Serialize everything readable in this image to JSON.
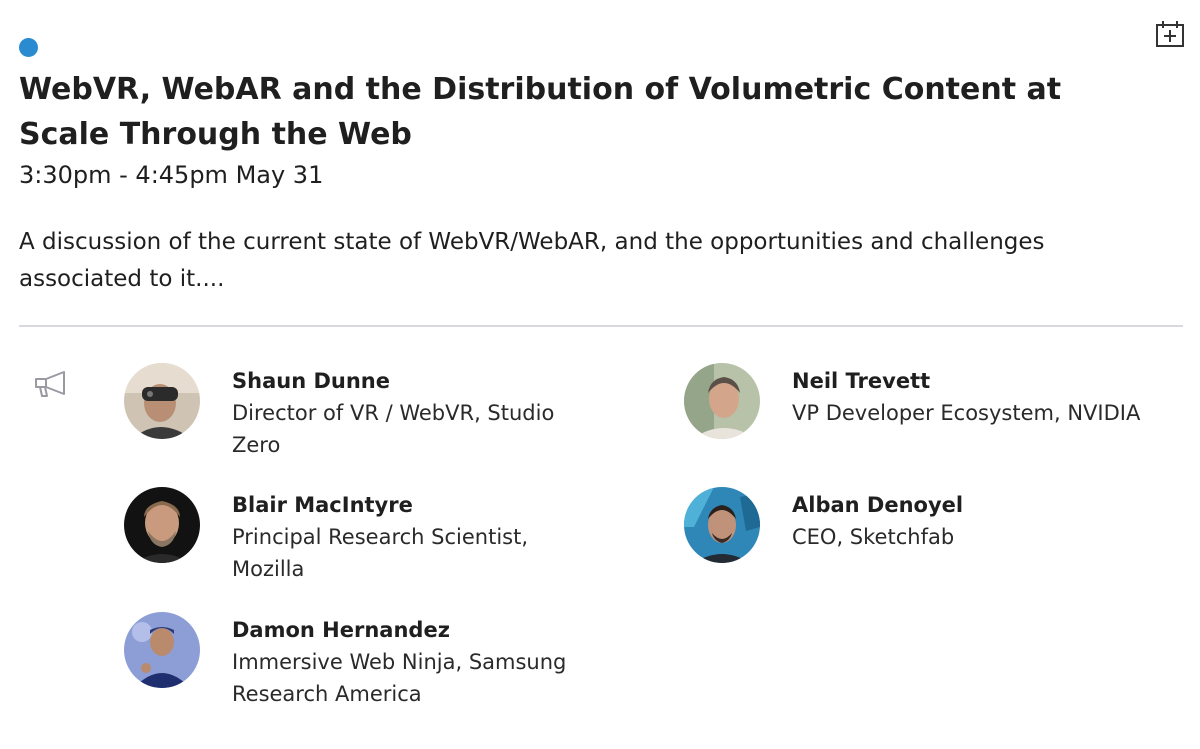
{
  "session": {
    "title": "WebVR, WebAR and the Distribution of Volumetric Content at Scale Through the Web",
    "time": "3:30pm - 4:45pm May 31",
    "description": "A discussion of the current state of WebVR/WebAR, and the opportunities and challenges associated to it....",
    "status_color": "#2a8bd0"
  },
  "actions": {
    "add_to_calendar_icon": "calendar-plus-icon"
  },
  "speakers": [
    {
      "name": "Shaun Dunne",
      "role": "Director of VR / WebVR, Studio Zero"
    },
    {
      "name": "Blair MacIntyre",
      "role": "Principal Research Scientist, Mozilla"
    },
    {
      "name": "Damon Hernandez",
      "role": "Immersive Web Ninja, Samsung Research America"
    },
    {
      "name": "Neil Trevett",
      "role": "VP Developer Ecosystem, NVIDIA"
    },
    {
      "name": "Alban Denoyel",
      "role": "CEO, Sketchfab"
    }
  ],
  "speaker_section_icon": "megaphone-icon"
}
